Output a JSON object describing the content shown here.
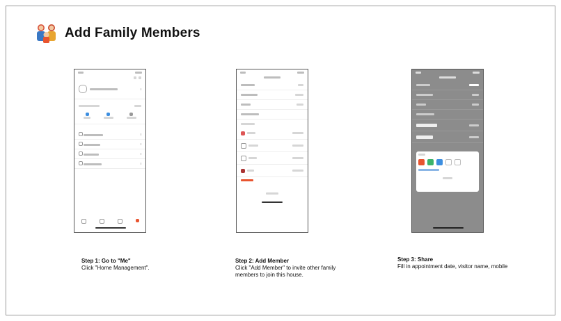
{
  "header": {
    "title": "Add Family Members",
    "logo_icon": "family-icon"
  },
  "steps": [
    {
      "title": "Step 1: Go to \"Me\"",
      "text": "Click \"Home Management\"."
    },
    {
      "title": "Step 2: Add Member",
      "text": "Click \"Add Member\" to invite other family members to join this house."
    },
    {
      "title": "Step 3: Share",
      "text": "Fill in appointment date, visitor name, mobile"
    }
  ],
  "colors": {
    "accent": "#e8542f",
    "blue": "#3c8ee0",
    "green": "#3bb36b",
    "border": "#9a9a9a"
  }
}
